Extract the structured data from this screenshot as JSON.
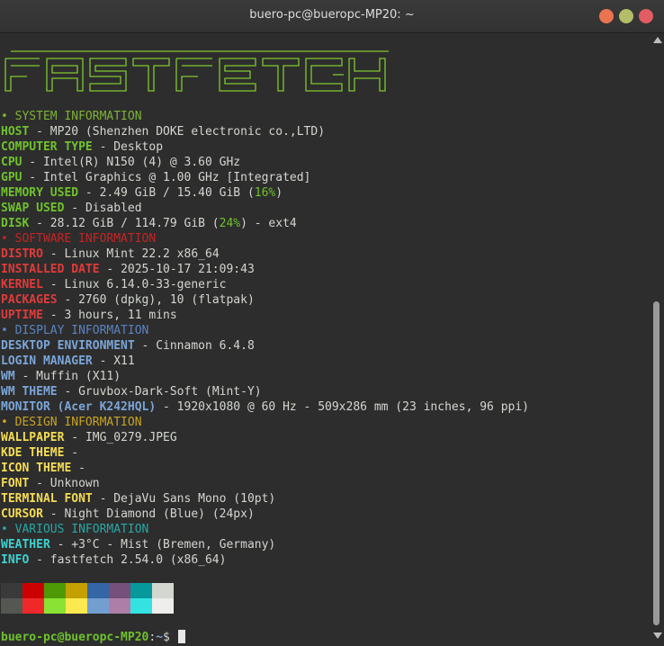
{
  "window": {
    "title": "buero-pc@bueropc-MP20: ~"
  },
  "icons": {
    "minimize": "minimize-icon",
    "maximize": "maximize-icon",
    "close": "close-icon"
  },
  "colors": {
    "green": "#6fc22c",
    "red": "#e23a3a",
    "blue": "#7ba5d8",
    "yellow": "#f4dc55",
    "cyan": "#3fd0d0",
    "background": "#2d2d2d"
  },
  "logo": {
    "text": "FASTFETCH"
  },
  "system": {
    "header": "SYSTEM INFORMATION",
    "host_k": "HOST",
    "host_v": "MP20 (Shenzhen DOKE electronic co.,LTD)",
    "type_k": "COMPUTER TYPE",
    "type_v": "Desktop",
    "cpu_k": "CPU",
    "cpu_v": "Intel(R) N150 (4) @ 3.60 GHz",
    "gpu_k": "GPU",
    "gpu_v": "Intel Graphics @ 1.00 GHz [Integrated]",
    "mem_k": "MEMORY USED",
    "mem_v": "2.49 GiB / 15.40 GiB (",
    "mem_pct": "16%",
    "mem_end": ")",
    "swap_k": "SWAP USED",
    "swap_v": "Disabled",
    "disk_k": "DISK",
    "disk_v": "28.12 GiB / 114.79 GiB (",
    "disk_pct": "24%",
    "disk_end": ") - ext4"
  },
  "software": {
    "header": "SOFTWARE INFORMATION",
    "distro_k": "DISTRO",
    "distro_v": "Linux Mint 22.2 x86_64",
    "inst_k": "INSTALLED DATE",
    "inst_v": "2025-10-17 21:09:43",
    "kernel_k": "KERNEL",
    "kernel_v": "Linux 6.14.0-33-generic",
    "pkg_k": "PACKAGES",
    "pkg_v": "2760 (dpkg), 10 (flatpak)",
    "up_k": "UPTIME",
    "up_v": "3 hours, 11 mins"
  },
  "display": {
    "header": "DISPLAY INFORMATION",
    "de_k": "DESKTOP ENVIRONMENT",
    "de_v": "Cinnamon 6.4.8",
    "lm_k": "LOGIN MANAGER",
    "lm_v": "X11",
    "wm_k": "WM",
    "wm_v": "Muffin (X11)",
    "wmt_k": "WM THEME",
    "wmt_v": "Gruvbox-Dark-Soft (Mint-Y)",
    "mon_k": "MONITOR (Acer K242HQL)",
    "mon_v": "1920x1080 @ 60 Hz - 509x286 mm (23 inches, 96 ppi)"
  },
  "design": {
    "header": "DESIGN INFORMATION",
    "wp_k": "WALLPAPER",
    "wp_v": "IMG_0279.JPEG",
    "kde_k": "KDE THEME",
    "kde_v": "",
    "icon_k": "ICON THEME",
    "icon_v": "",
    "font_k": "FONT",
    "font_v": "Unknown",
    "tf_k": "TERMINAL FONT",
    "tf_v": "DejaVu Sans Mono (10pt)",
    "cur_k": "CURSOR",
    "cur_v": "Night Diamond (Blue) (24px)"
  },
  "various": {
    "header": "VARIOUS INFORMATION",
    "weather_k": "WEATHER",
    "weather_v": "+3°C - Mist (Bremen, Germany)",
    "info_k": "INFO",
    "info_v": "fastfetch 2.54.0 (x86_64)"
  },
  "palette": {
    "normal": [
      "#3a3a3a",
      "#cc0000",
      "#4e9a06",
      "#c4a000",
      "#3465a4",
      "#75507b",
      "#06989a",
      "#d3d7cf"
    ],
    "bright": [
      "#555753",
      "#ef2929",
      "#8ae234",
      "#fce94f",
      "#729fcf",
      "#ad7fa8",
      "#34e2e2",
      "#eeeeec"
    ]
  },
  "prompt": {
    "user": "buero-pc@bueropc-MP20",
    "sep": ":",
    "path": "~",
    "symbol": "$ "
  }
}
